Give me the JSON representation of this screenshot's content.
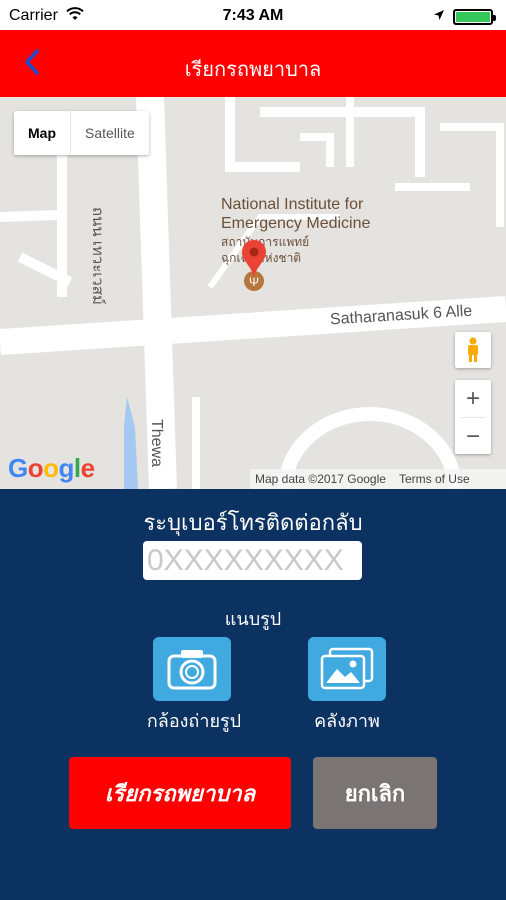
{
  "status_bar": {
    "carrier": "Carrier",
    "time": "7:43 AM",
    "battery_percent": 100
  },
  "navbar": {
    "title": "เรียกรถพยาบาล",
    "back_icon": "chevron-left-icon"
  },
  "map": {
    "map_type": {
      "map": "Map",
      "satellite": "Satellite"
    },
    "poi": {
      "name_line1": "National Institute for",
      "name_line2": "Emergency Medicine",
      "thai_line1": "สถาบันการแพทย์",
      "thai_line2": "ฉุกเฉินแห่งชาติ"
    },
    "streets": {
      "vertical_thai": "ถนน เทวะเวสม์",
      "horizontal": "Satharanasuk 6 Alle",
      "thewa": "Thewa"
    },
    "zoom_in": "+",
    "zoom_out": "−",
    "google_logo": "Google",
    "attribution": "Map data ©2017 Google",
    "terms": "Terms of Use",
    "colors": {
      "marker": "#ea4335",
      "road": "#ffffff",
      "water": "#a5c8f0"
    }
  },
  "form": {
    "phone_label": "ระบุเบอร์โทรติดต่อกลับ",
    "phone_placeholder": "0XXXXXXXXX",
    "attach_label": "แนบรูป",
    "camera_label": "กล้องถ่ายรูป",
    "gallery_label": "คลังภาพ",
    "call_button": "เรียกรถพยาบาล",
    "cancel_button": "ยกเลิก"
  },
  "colors": {
    "navbar": "#ff0000",
    "form_background": "#0b3260",
    "tile": "#3fa9e0",
    "call_button": "#ff0000",
    "cancel_button": "#7a7472"
  }
}
